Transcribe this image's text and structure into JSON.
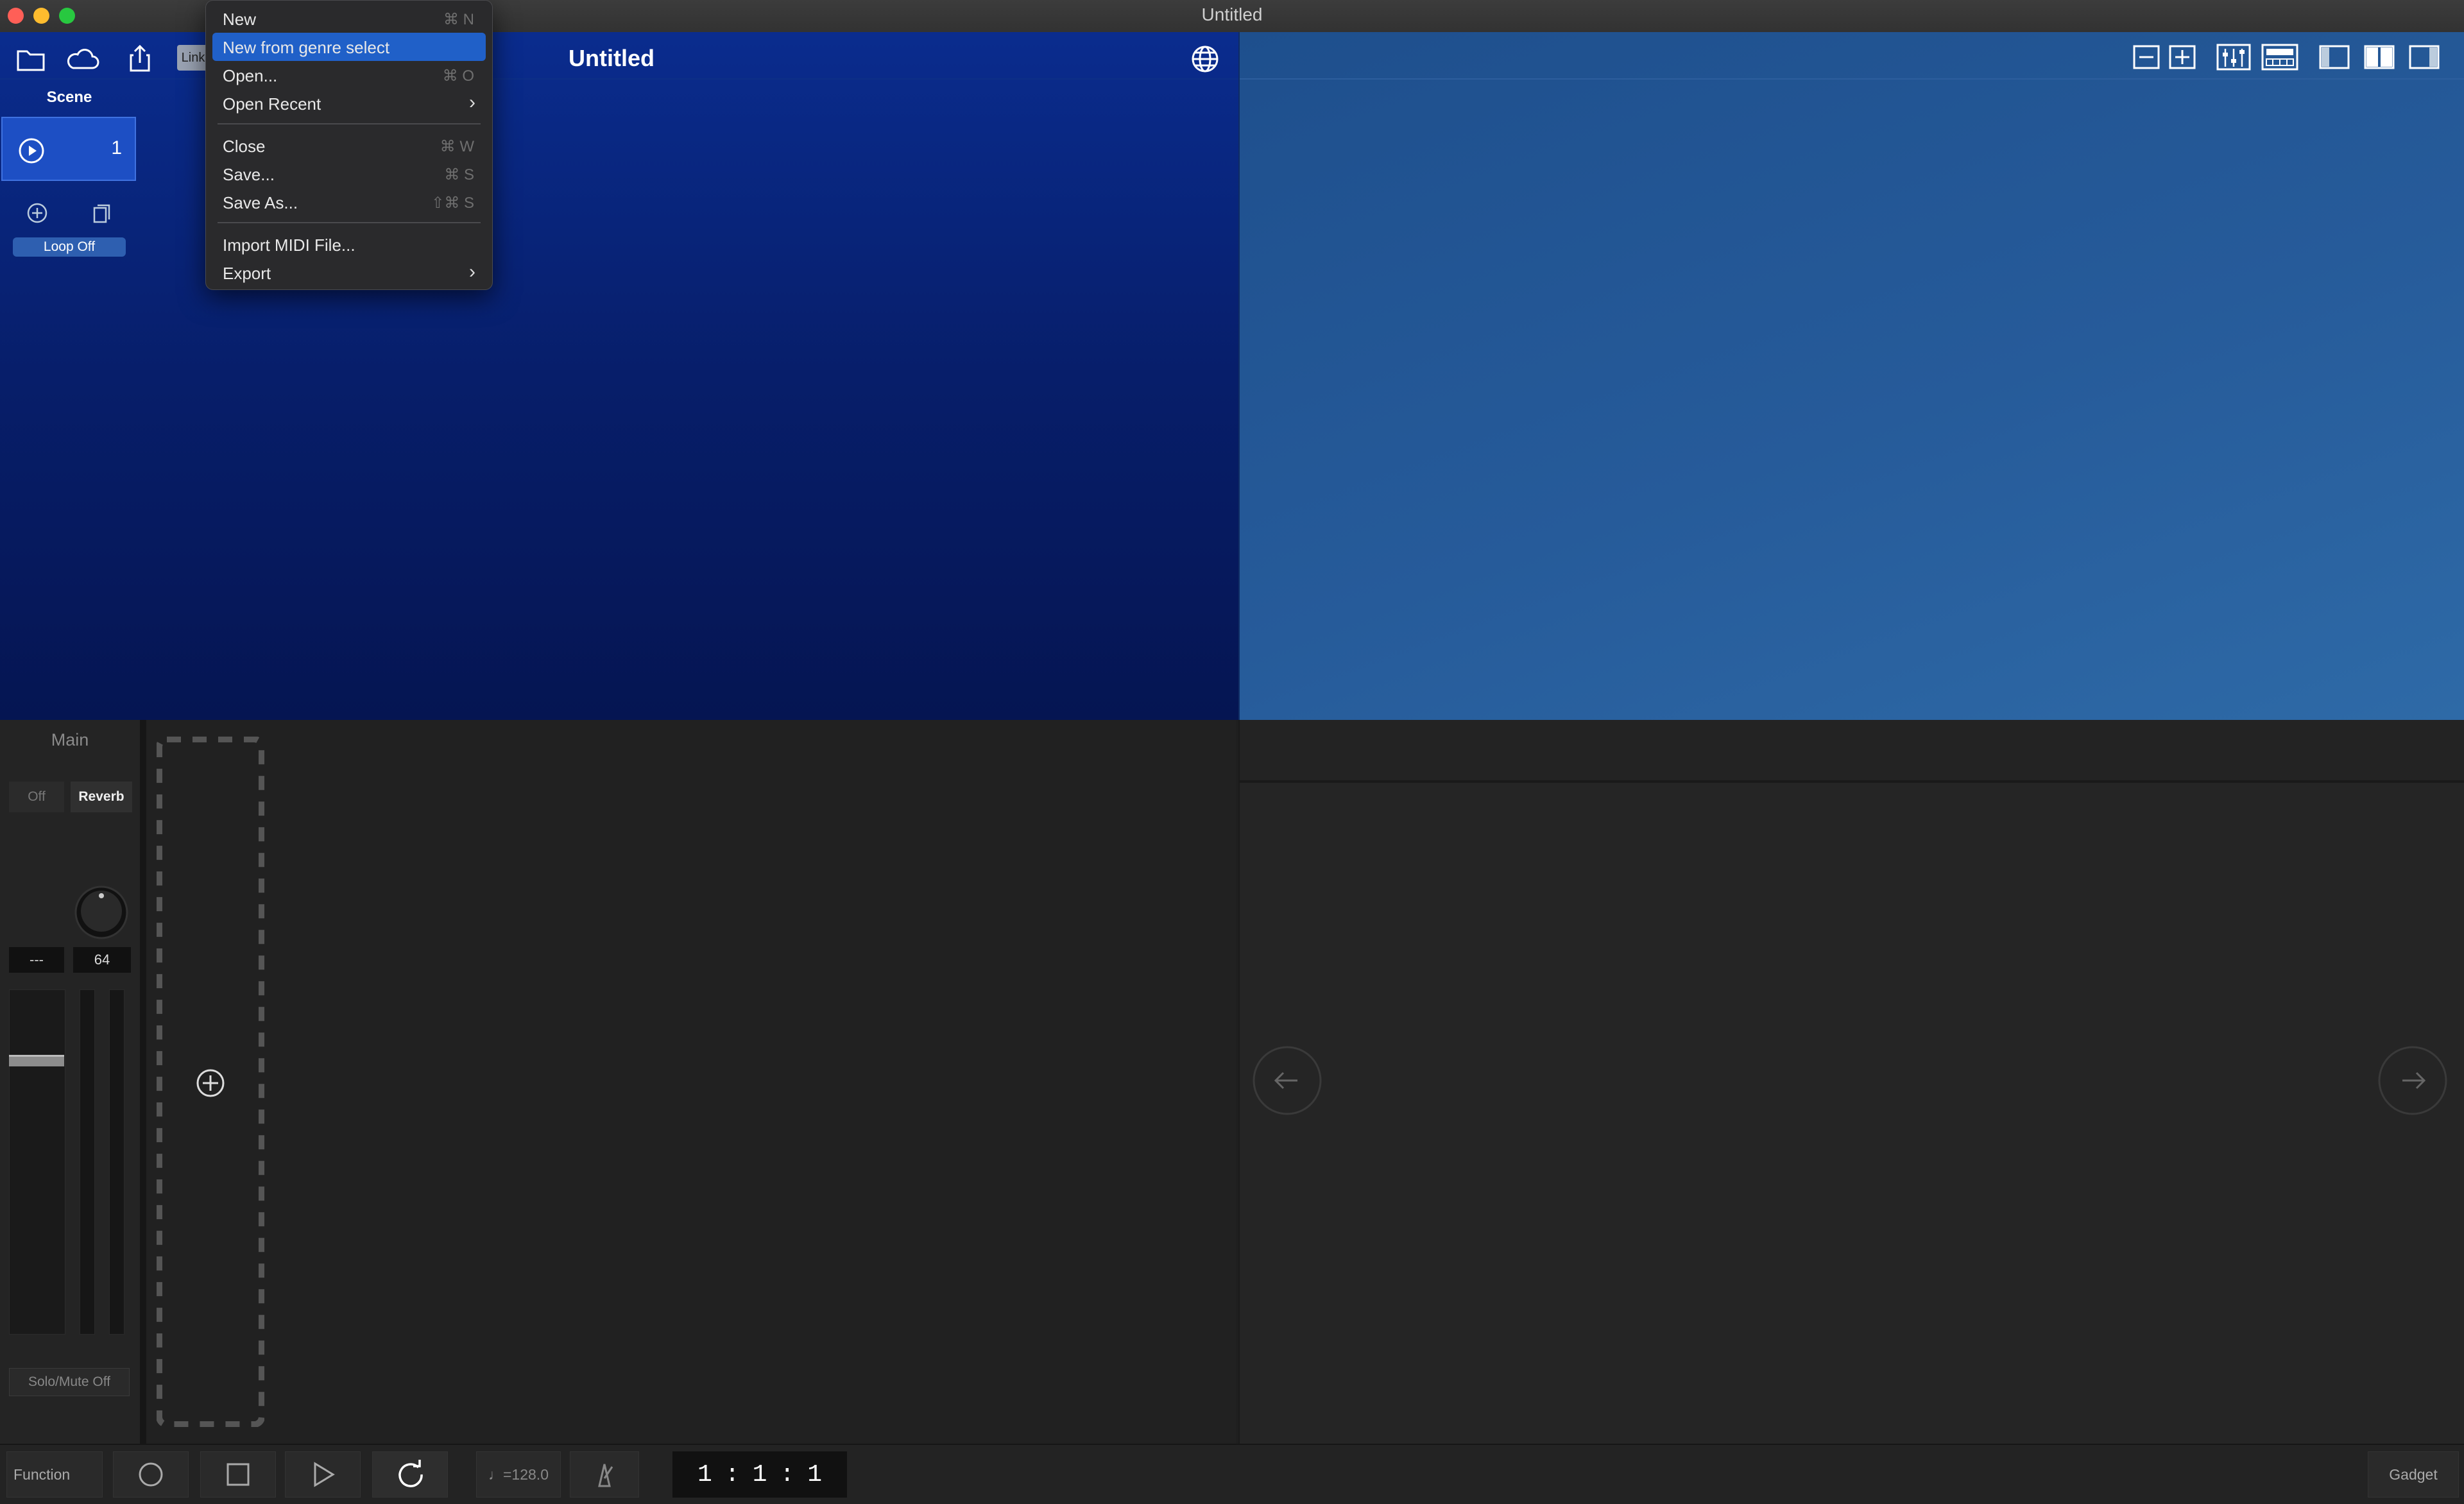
{
  "window": {
    "title": "Untitled"
  },
  "toolbar": {
    "link_label": "Link",
    "song_title": "Untitled",
    "icons": [
      "folder-icon",
      "cloud-icon",
      "share-icon",
      "globe-icon"
    ]
  },
  "scene": {
    "header": "Scene",
    "number": "1",
    "loop_label": "Loop Off"
  },
  "right_toolbar": {
    "icons": [
      "zoom-out-icon",
      "zoom-in-icon",
      "mixer-icon",
      "keyboard-icon",
      "layout-left-icon",
      "layout-split-icon",
      "layout-right-icon"
    ]
  },
  "file_menu": {
    "items": [
      {
        "label": "New",
        "shortcut": "⌘ N"
      },
      {
        "label": "New from genre select",
        "shortcut": "",
        "highlighted": true
      },
      {
        "label": "Open...",
        "shortcut": "⌘ O"
      },
      {
        "label": "Open Recent",
        "submenu": true
      },
      {
        "label": "Close",
        "shortcut": "⌘ W"
      },
      {
        "label": "Save...",
        "shortcut": "⌘ S"
      },
      {
        "label": "Save As...",
        "shortcut": "⇧⌘ S"
      },
      {
        "label": "Import MIDI File...",
        "shortcut": ""
      },
      {
        "label": "Export",
        "submenu": true
      }
    ],
    "submenu_arrow": "›"
  },
  "mixer": {
    "main_label": "Main",
    "send_off": "Off",
    "send_reverb": "Reverb",
    "value_left": "---",
    "value_right": "64",
    "solo_mute": "Solo/Mute Off"
  },
  "transport": {
    "function_label": "Function",
    "tempo": "♩=128.0",
    "position": {
      "bar": "1",
      "beat": "1",
      "tick": "1",
      "separator": ":"
    },
    "gadget_label": "Gadget"
  },
  "colors": {
    "highlight": "#2060c8",
    "arranger_bg": "#0a2c8e",
    "right_panel_bg": "#265b9a"
  }
}
